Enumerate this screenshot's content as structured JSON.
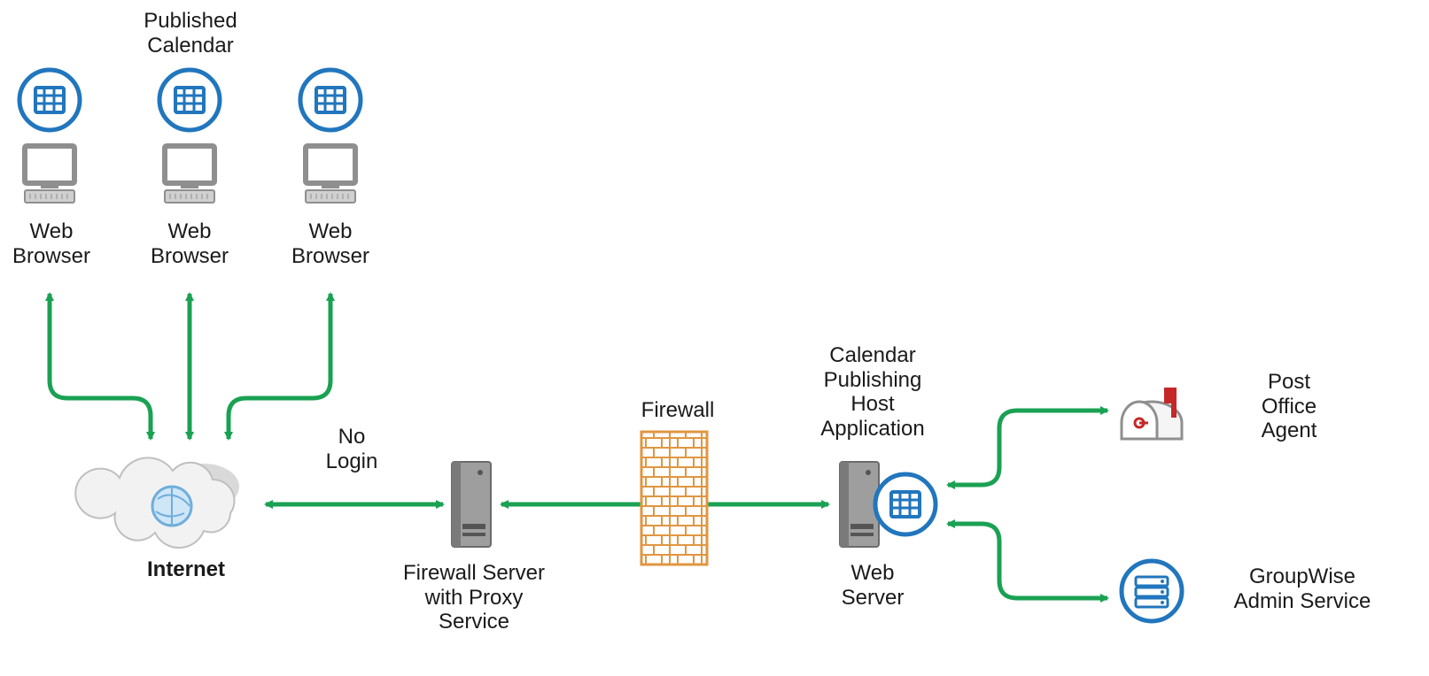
{
  "labels": {
    "published_calendar": "Published\nCalendar",
    "web_browser_1": "Web\nBrowser",
    "web_browser_2": "Web\nBrowser",
    "web_browser_3": "Web\nBrowser",
    "internet": "Internet",
    "no_login": "No\nLogin",
    "firewall_server": "Firewall Server\nwith Proxy\nService",
    "firewall": "Firewall",
    "cph_app": "Calendar\nPublishing\nHost\nApplication",
    "web_server": "Web\nServer",
    "post_office_agent": "Post\nOffice\nAgent",
    "groupwise_admin": "GroupWise\nAdmin Service"
  },
  "colors": {
    "blue": "#2176bd",
    "green": "#1aa153",
    "orange": "#e09641",
    "gray": "#8f8f8f",
    "darkgray": "#555555",
    "red": "#c62828",
    "cloud": "#d9d9d9"
  }
}
